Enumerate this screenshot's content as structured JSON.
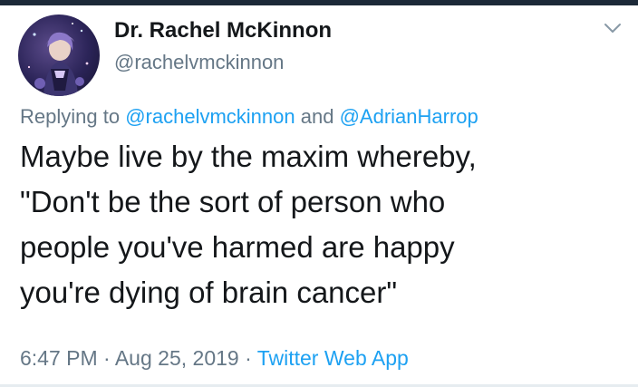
{
  "author": {
    "display_name": "Dr. Rachel McKinnon",
    "handle": "@rachelvmckinnon"
  },
  "reply": {
    "prefix": "Replying to",
    "mention_1": "@rachelvmckinnon",
    "joiner": "and",
    "mention_2": "@AdrianHarrop"
  },
  "tweet": {
    "lines": [
      "Maybe live by the maxim whereby,",
      "\"Don't be the sort of person who",
      "people you've harmed are happy",
      "you're dying of brain cancer\""
    ]
  },
  "meta": {
    "time": "6:47 PM",
    "separator": "·",
    "date": "Aug 25, 2019",
    "source": "Twitter Web App"
  },
  "icons": {
    "menu": "chevron-down-icon",
    "avatar": "avatar"
  },
  "colors": {
    "text": "#14171a",
    "secondary": "#657786",
    "link": "#1da1f2",
    "top_strip": "#1c2938"
  }
}
